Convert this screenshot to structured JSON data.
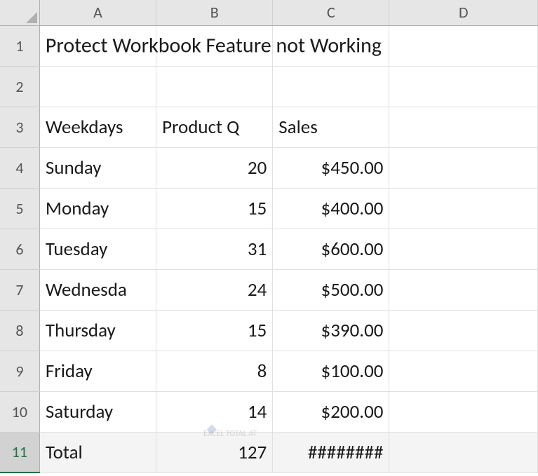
{
  "columns": [
    "A",
    "B",
    "C",
    "D"
  ],
  "row_numbers": [
    "1",
    "2",
    "3",
    "4",
    "5",
    "6",
    "7",
    "8",
    "9",
    "10",
    "11"
  ],
  "title": "Protect Workbook Feature not Working",
  "headers": {
    "col_a": "Weekdays",
    "col_b": "Product Q",
    "col_c": "Sales"
  },
  "rows": [
    {
      "day": "Sunday",
      "qty": "20",
      "sales": "$450.00"
    },
    {
      "day": "Monday",
      "qty": "15",
      "sales": "$400.00"
    },
    {
      "day": "Tuesday",
      "qty": "31",
      "sales": "$600.00"
    },
    {
      "day": "Wednesda",
      "qty": "24",
      "sales": "$500.00"
    },
    {
      "day": "Thursday",
      "qty": "15",
      "sales": "$390.00"
    },
    {
      "day": "Friday",
      "qty": "8",
      "sales": "$100.00"
    },
    {
      "day": "Saturday",
      "qty": "14",
      "sales": "$200.00"
    }
  ],
  "total": {
    "label": "Total",
    "qty": "127",
    "sales": "########"
  },
  "watermark": "EXCEL TOTAL AT"
}
